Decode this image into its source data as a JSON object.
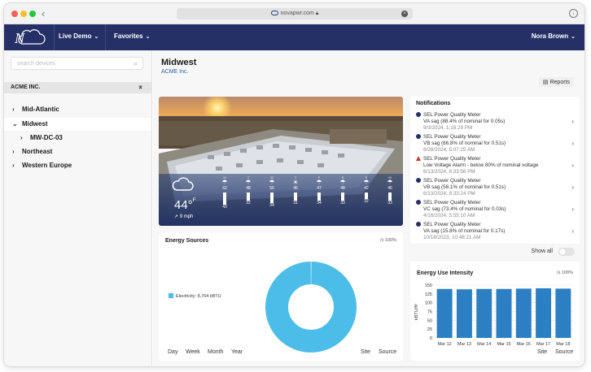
{
  "browser": {
    "url": "novapwr.com"
  },
  "nav": {
    "logo_letter": "N",
    "live_demo": "Live Demo",
    "favorites": "Favorites",
    "user": "Nora Brown"
  },
  "sidebar": {
    "search_placeholder": "search devices",
    "org": "ACME INC.",
    "items": [
      {
        "label": "Mid-Atlantic",
        "chevron": "›"
      },
      {
        "label": "Midwest",
        "chevron": "⌄"
      },
      {
        "label": "MW-DC-03",
        "chevron": "›"
      },
      {
        "label": "Northeast",
        "chevron": "›"
      },
      {
        "label": "Western Europe",
        "chevron": "›"
      }
    ]
  },
  "main": {
    "title": "Midwest",
    "subtitle": "ACME Inc.",
    "reports": "Reports"
  },
  "weather": {
    "temp": "44°",
    "unit": "F",
    "wind": "9 mph",
    "hours": [
      {
        "label": "M",
        "icon": "rain",
        "high": "62",
        "low": "43",
        "level": 0.8
      },
      {
        "label": "T",
        "icon": "rain",
        "high": "48",
        "low": "32",
        "level": 0.45
      },
      {
        "label": "W",
        "icon": "rain",
        "high": "56",
        "low": "34",
        "level": 0.65
      },
      {
        "label": "T",
        "icon": "sun",
        "high": "46",
        "low": "31",
        "level": 0.4
      },
      {
        "label": "F",
        "icon": "rain",
        "high": "47",
        "low": "34",
        "level": 0.42
      },
      {
        "label": "S",
        "icon": "rain",
        "high": "48",
        "low": "33",
        "level": 0.45
      },
      {
        "label": "S",
        "icon": "rain",
        "high": "42",
        "low": "32",
        "level": 0.3
      },
      {
        "label": "M",
        "icon": "rain",
        "high": "46",
        "low": "33",
        "level": 0.4
      }
    ]
  },
  "notifications": {
    "title": "Notifications",
    "items": [
      {
        "type": "info",
        "source": "SEL Power Quality Meter",
        "message": "VA sag (88.4% of nominal for 0.05s)",
        "time": "9/3/2024, 1:18:29 PM"
      },
      {
        "type": "info",
        "source": "SEL Power Quality Meter",
        "message": "VB sag (86.8% of nominal for 0.51s)",
        "time": "6/28/2024, 5:07:25 AM"
      },
      {
        "type": "warn",
        "source": "SEL Power Quality Meter",
        "message": "Low Voltage Alarm - below 80% of nominal voltage",
        "time": "6/13/2024, 8:33:56 PM"
      },
      {
        "type": "info",
        "source": "SEL Power Quality Meter",
        "message": "VB sag (58.1% of nominal for 0.51s)",
        "time": "6/13/2024, 8:33:24 PM"
      },
      {
        "type": "info",
        "source": "SEL Power Quality Meter",
        "message": "VC sag (73.4% of nominal for 0.03s)",
        "time": "4/16/2024, 5:55:10 AM"
      },
      {
        "type": "info",
        "source": "SEL Power Quality Meter",
        "message": "VA sag (15.8% of nominal for 0.17s)",
        "time": "10/18/2023, 10:48:21 AM"
      }
    ],
    "show_all": "Show all"
  },
  "energy_sources": {
    "title": "Energy Sources",
    "pct": "100%",
    "legend": "Electricity: 8,764 kBTU",
    "tabs": [
      "Day",
      "Week",
      "Month",
      "Year"
    ],
    "right_tabs": [
      "Site",
      "Source"
    ]
  },
  "eui": {
    "title": "Energy Use Intensity",
    "pct": "100%",
    "right_tabs": [
      "Site",
      "Source"
    ]
  },
  "chart_data": [
    {
      "type": "pie",
      "title": "Energy Sources",
      "categories": [
        "Electricity"
      ],
      "values": [
        8764
      ],
      "unit": "kBTU",
      "colors": [
        "#4cbde8"
      ]
    },
    {
      "type": "bar",
      "title": "Energy Use Intensity",
      "categories": [
        "Mar 12",
        "Mar 13",
        "Mar 14",
        "Mar 15",
        "Mar 16",
        "Mar 17",
        "Mar 18"
      ],
      "values": [
        139,
        138,
        139,
        139,
        140,
        141,
        140
      ],
      "ylabel": "kBTU/ft²",
      "ylim": [
        0,
        150
      ],
      "yticks": [
        "0",
        "25",
        "50",
        "75",
        "100",
        "125",
        "150"
      ],
      "color": "#2b7fc2",
      "grid": true
    }
  ],
  "colors": {
    "nav_bg": "#253066",
    "accent": "#2a5db0",
    "bar": "#2b7fc2",
    "donut": "#4cbde8"
  }
}
